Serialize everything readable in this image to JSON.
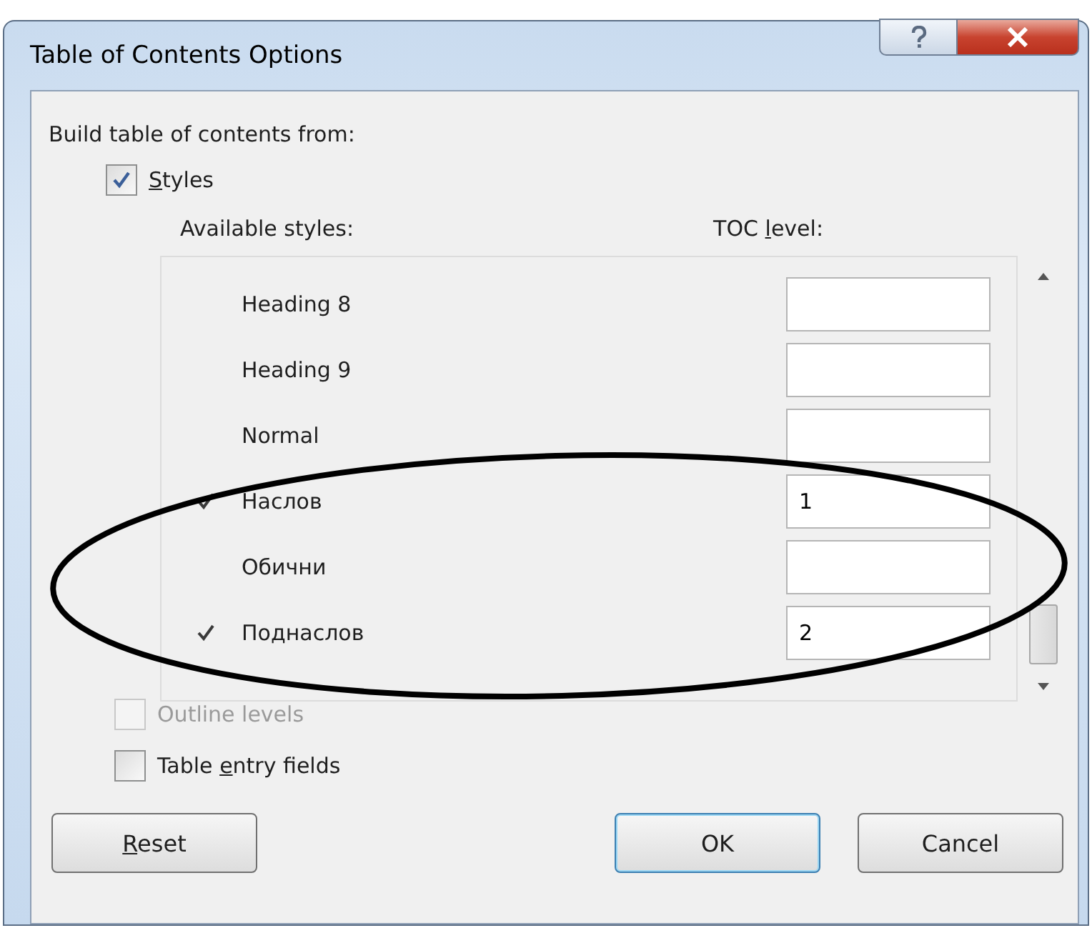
{
  "window": {
    "title": "Table of Contents Options"
  },
  "build_from": {
    "label": "Build table of contents from:"
  },
  "styles_option": {
    "label": {
      "key": "S",
      "after": "tyles"
    },
    "checked": true
  },
  "columns": {
    "available": {
      "text": "Available styles:"
    },
    "toc_level": {
      "before": "TOC ",
      "key": "l",
      "after": "evel:"
    }
  },
  "styles": [
    {
      "name": "Heading 8",
      "checked": false
    },
    {
      "name": "Heading 9",
      "checked": false
    },
    {
      "name": "Normal",
      "checked": false
    },
    {
      "name": "Наслов",
      "checked": true,
      "toc_level": "1"
    },
    {
      "name": "Обични",
      "checked": false
    },
    {
      "name": "Поднаслов",
      "checked": true,
      "toc_level": "2"
    }
  ],
  "options": [
    {
      "label": {
        "text": "Outline levels"
      },
      "checked": false,
      "disabled": true
    },
    {
      "label": {
        "before": "Table ",
        "key": "e",
        "after": "ntry fields"
      },
      "checked": false,
      "disabled": false
    }
  ],
  "buttons": [
    {
      "label": {
        "key": "R",
        "after": "eset"
      },
      "default": false
    },
    {
      "label": {
        "text": "OK"
      },
      "default": true
    },
    {
      "label": {
        "text": "Cancel"
      },
      "default": false
    }
  ]
}
